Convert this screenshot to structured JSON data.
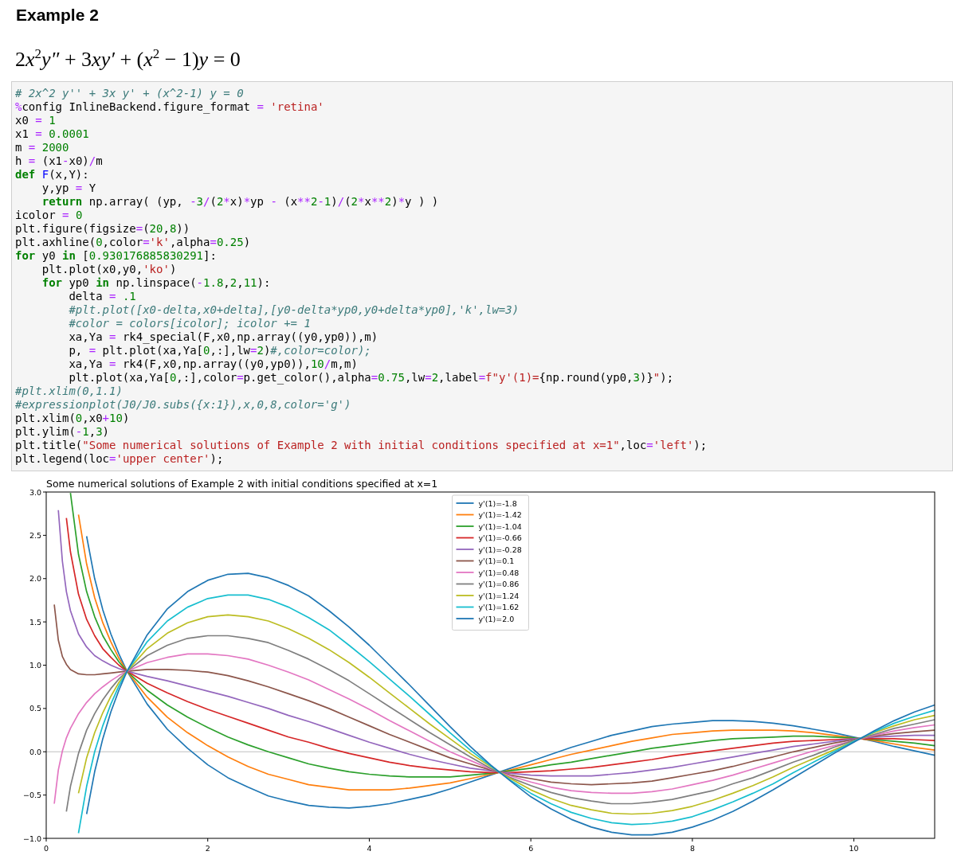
{
  "heading": "Example 2",
  "equation": [
    {
      "kind": "number",
      "text": "2"
    },
    {
      "kind": "variable",
      "text": "x"
    },
    {
      "kind": "power",
      "text": "2"
    },
    {
      "kind": "variable",
      "text": "y″"
    },
    {
      "kind": "operator",
      "text": " + 3"
    },
    {
      "kind": "variable",
      "text": "xy′"
    },
    {
      "kind": "operator",
      "text": " + ("
    },
    {
      "kind": "variable",
      "text": "x"
    },
    {
      "kind": "power",
      "text": "2"
    },
    {
      "kind": "operator",
      "text": " − 1)"
    },
    {
      "kind": "variable",
      "text": "y"
    },
    {
      "kind": "operator",
      "text": " = 0"
    }
  ],
  "code_cell": {
    "lines": [
      [
        {
          "kind": "comment",
          "text": "# 2x^2 y'' + 3x y' + (x^2-1) y = 0"
        }
      ],
      [
        {
          "kind": "operator",
          "text": "%"
        },
        {
          "kind": "text",
          "text": "config InlineBackend.figure_format "
        },
        {
          "kind": "operator",
          "text": "="
        },
        {
          "kind": "string",
          "text": " 'retina'"
        }
      ],
      [
        {
          "kind": "text",
          "text": "x0 "
        },
        {
          "kind": "operator",
          "text": "="
        },
        {
          "kind": "number",
          "text": " 1"
        }
      ],
      [
        {
          "kind": "text",
          "text": "x1 "
        },
        {
          "kind": "operator",
          "text": "="
        },
        {
          "kind": "number",
          "text": " 0.0001"
        }
      ],
      [
        {
          "kind": "text",
          "text": "m "
        },
        {
          "kind": "operator",
          "text": "="
        },
        {
          "kind": "number",
          "text": " 2000"
        }
      ],
      [
        {
          "kind": "text",
          "text": "h "
        },
        {
          "kind": "operator",
          "text": "="
        },
        {
          "kind": "text",
          "text": " (x1"
        },
        {
          "kind": "operator",
          "text": "-"
        },
        {
          "kind": "text",
          "text": "x0)"
        },
        {
          "kind": "operator",
          "text": "/"
        },
        {
          "kind": "text",
          "text": "m"
        }
      ],
      [
        {
          "kind": "keyword",
          "text": "def"
        },
        {
          "kind": "name",
          "text": " F"
        },
        {
          "kind": "text",
          "text": "(x,Y):"
        }
      ],
      [
        {
          "kind": "text",
          "text": "    y,yp "
        },
        {
          "kind": "operator",
          "text": "="
        },
        {
          "kind": "text",
          "text": " Y"
        }
      ],
      [
        {
          "kind": "keyword",
          "text": "    return"
        },
        {
          "kind": "text",
          "text": " np.array( (yp, "
        },
        {
          "kind": "operator",
          "text": "-"
        },
        {
          "kind": "number",
          "text": "3"
        },
        {
          "kind": "operator",
          "text": "/"
        },
        {
          "kind": "text",
          "text": "("
        },
        {
          "kind": "number",
          "text": "2"
        },
        {
          "kind": "operator",
          "text": "*"
        },
        {
          "kind": "text",
          "text": "x)"
        },
        {
          "kind": "operator",
          "text": "*"
        },
        {
          "kind": "text",
          "text": "yp "
        },
        {
          "kind": "operator",
          "text": "-"
        },
        {
          "kind": "text",
          "text": " (x"
        },
        {
          "kind": "operator",
          "text": "**"
        },
        {
          "kind": "number",
          "text": "2"
        },
        {
          "kind": "operator",
          "text": "-"
        },
        {
          "kind": "number",
          "text": "1"
        },
        {
          "kind": "text",
          "text": ")"
        },
        {
          "kind": "operator",
          "text": "/"
        },
        {
          "kind": "text",
          "text": "("
        },
        {
          "kind": "number",
          "text": "2"
        },
        {
          "kind": "operator",
          "text": "*"
        },
        {
          "kind": "text",
          "text": "x"
        },
        {
          "kind": "operator",
          "text": "**"
        },
        {
          "kind": "number",
          "text": "2"
        },
        {
          "kind": "text",
          "text": ")"
        },
        {
          "kind": "operator",
          "text": "*"
        },
        {
          "kind": "text",
          "text": "y ) )"
        }
      ],
      [
        {
          "kind": "text",
          "text": "icolor "
        },
        {
          "kind": "operator",
          "text": "="
        },
        {
          "kind": "number",
          "text": " 0"
        }
      ],
      [
        {
          "kind": "text",
          "text": "plt.figure(figsize"
        },
        {
          "kind": "operator",
          "text": "="
        },
        {
          "kind": "text",
          "text": "("
        },
        {
          "kind": "number",
          "text": "20"
        },
        {
          "kind": "text",
          "text": ","
        },
        {
          "kind": "number",
          "text": "8"
        },
        {
          "kind": "text",
          "text": "))"
        }
      ],
      [
        {
          "kind": "text",
          "text": "plt.axhline("
        },
        {
          "kind": "number",
          "text": "0"
        },
        {
          "kind": "text",
          "text": ",color"
        },
        {
          "kind": "operator",
          "text": "="
        },
        {
          "kind": "string",
          "text": "'k'"
        },
        {
          "kind": "text",
          "text": ",alpha"
        },
        {
          "kind": "operator",
          "text": "="
        },
        {
          "kind": "number",
          "text": "0.25"
        },
        {
          "kind": "text",
          "text": ")"
        }
      ],
      [
        {
          "kind": "keyword",
          "text": "for"
        },
        {
          "kind": "text",
          "text": " y0 "
        },
        {
          "kind": "keyword",
          "text": "in"
        },
        {
          "kind": "text",
          "text": " ["
        },
        {
          "kind": "number",
          "text": "0.930176885830291"
        },
        {
          "kind": "text",
          "text": "]:"
        }
      ],
      [
        {
          "kind": "text",
          "text": "    plt.plot(x0,y0,"
        },
        {
          "kind": "string",
          "text": "'ko'"
        },
        {
          "kind": "text",
          "text": ")"
        }
      ],
      [
        {
          "kind": "keyword",
          "text": "    for"
        },
        {
          "kind": "text",
          "text": " yp0 "
        },
        {
          "kind": "keyword",
          "text": "in"
        },
        {
          "kind": "text",
          "text": " np.linspace("
        },
        {
          "kind": "operator",
          "text": "-"
        },
        {
          "kind": "number",
          "text": "1.8"
        },
        {
          "kind": "text",
          "text": ","
        },
        {
          "kind": "number",
          "text": "2"
        },
        {
          "kind": "text",
          "text": ","
        },
        {
          "kind": "number",
          "text": "11"
        },
        {
          "kind": "text",
          "text": "):"
        }
      ],
      [
        {
          "kind": "text",
          "text": "        delta "
        },
        {
          "kind": "operator",
          "text": "="
        },
        {
          "kind": "number",
          "text": " .1"
        }
      ],
      [
        {
          "kind": "comment",
          "text": "        #plt.plot([x0-delta,x0+delta],[y0-delta*yp0,y0+delta*yp0],'k',lw=3)"
        }
      ],
      [
        {
          "kind": "comment",
          "text": "        #color = colors[icolor]; icolor += 1"
        }
      ],
      [
        {
          "kind": "text",
          "text": "        xa,Ya "
        },
        {
          "kind": "operator",
          "text": "="
        },
        {
          "kind": "text",
          "text": " rk4_special(F,x0,np.array((y0,yp0)),m)"
        }
      ],
      [
        {
          "kind": "text",
          "text": "        p, "
        },
        {
          "kind": "operator",
          "text": "="
        },
        {
          "kind": "text",
          "text": " plt.plot(xa,Ya["
        },
        {
          "kind": "number",
          "text": "0"
        },
        {
          "kind": "text",
          "text": ",:],lw"
        },
        {
          "kind": "operator",
          "text": "="
        },
        {
          "kind": "number",
          "text": "2"
        },
        {
          "kind": "text",
          "text": ")"
        },
        {
          "kind": "comment",
          "text": "#,color=color);"
        }
      ],
      [
        {
          "kind": "text",
          "text": "        xa,Ya "
        },
        {
          "kind": "operator",
          "text": "="
        },
        {
          "kind": "text",
          "text": " rk4(F,x0,np.array((y0,yp0)),"
        },
        {
          "kind": "number",
          "text": "10"
        },
        {
          "kind": "operator",
          "text": "/"
        },
        {
          "kind": "text",
          "text": "m,m)"
        }
      ],
      [
        {
          "kind": "text",
          "text": "        plt.plot(xa,Ya["
        },
        {
          "kind": "number",
          "text": "0"
        },
        {
          "kind": "text",
          "text": ",:],color"
        },
        {
          "kind": "operator",
          "text": "="
        },
        {
          "kind": "text",
          "text": "p.get_color(),alpha"
        },
        {
          "kind": "operator",
          "text": "="
        },
        {
          "kind": "number",
          "text": "0.75"
        },
        {
          "kind": "text",
          "text": ",lw"
        },
        {
          "kind": "operator",
          "text": "="
        },
        {
          "kind": "number",
          "text": "2"
        },
        {
          "kind": "text",
          "text": ",label"
        },
        {
          "kind": "operator",
          "text": "="
        },
        {
          "kind": "string",
          "text": "f\"y'(1)="
        },
        {
          "kind": "text",
          "text": "{np.round(yp0,"
        },
        {
          "kind": "number",
          "text": "3"
        },
        {
          "kind": "text",
          "text": ")}"
        },
        {
          "kind": "string",
          "text": "\""
        },
        {
          "kind": "text",
          "text": ");"
        }
      ],
      [
        {
          "kind": "comment",
          "text": "#plt.xlim(0,1.1)"
        }
      ],
      [
        {
          "kind": "comment",
          "text": "#expressionplot(J0/J0.subs({x:1}),x,0,8,color='g')"
        }
      ],
      [
        {
          "kind": "text",
          "text": "plt.xlim("
        },
        {
          "kind": "number",
          "text": "0"
        },
        {
          "kind": "text",
          "text": ",x0"
        },
        {
          "kind": "operator",
          "text": "+"
        },
        {
          "kind": "number",
          "text": "10"
        },
        {
          "kind": "text",
          "text": ")"
        }
      ],
      [
        {
          "kind": "text",
          "text": "plt.ylim("
        },
        {
          "kind": "operator",
          "text": "-"
        },
        {
          "kind": "number",
          "text": "1"
        },
        {
          "kind": "text",
          "text": ","
        },
        {
          "kind": "number",
          "text": "3"
        },
        {
          "kind": "text",
          "text": ")"
        }
      ],
      [
        {
          "kind": "text",
          "text": "plt.title("
        },
        {
          "kind": "string",
          "text": "\"Some numerical solutions of Example 2 with initial conditions specified at x=1\""
        },
        {
          "kind": "text",
          "text": ",loc"
        },
        {
          "kind": "operator",
          "text": "="
        },
        {
          "kind": "string",
          "text": "'left'"
        },
        {
          "kind": "text",
          "text": ");"
        }
      ],
      [
        {
          "kind": "text",
          "text": "plt.legend(loc"
        },
        {
          "kind": "operator",
          "text": "="
        },
        {
          "kind": "string",
          "text": "'upper center'"
        },
        {
          "kind": "text",
          "text": ");"
        }
      ]
    ]
  },
  "output": {
    "chart_data": {
      "type": "line",
      "title": "Some numerical solutions of Example 2 with initial conditions specified at x=1",
      "x": [
        0.1,
        0.15,
        0.2,
        0.25,
        0.3,
        0.4,
        0.5,
        0.6,
        0.7,
        0.8,
        0.9,
        1,
        1.25,
        1.5,
        1.75,
        2,
        2.25,
        2.5,
        2.75,
        3,
        3.25,
        3.5,
        3.75,
        4,
        4.25,
        4.5,
        4.75,
        5,
        5.25,
        5.5,
        5.75,
        6,
        6.25,
        6.5,
        6.75,
        7,
        7.25,
        7.5,
        7.75,
        8,
        8.25,
        8.5,
        8.75,
        9,
        9.25,
        9.5,
        9.75,
        10,
        10.25,
        10.5,
        10.75,
        11
      ],
      "xlim": [
        0,
        11
      ],
      "ylim": [
        -1,
        3
      ],
      "xticks": [
        {
          "value": 0,
          "label": "0"
        },
        {
          "value": 2,
          "label": "2"
        },
        {
          "value": 4,
          "label": "4"
        },
        {
          "value": 6,
          "label": "6"
        },
        {
          "value": 8,
          "label": "8"
        },
        {
          "value": 10,
          "label": "10"
        }
      ],
      "yticks": [
        {
          "value": -1,
          "label": "−1.0"
        },
        {
          "value": -0.5,
          "label": "−0.5"
        },
        {
          "value": 0,
          "label": "0.0"
        },
        {
          "value": 0.5,
          "label": "0.5"
        },
        {
          "value": 1,
          "label": "1.0"
        },
        {
          "value": 1.5,
          "label": "1.5"
        },
        {
          "value": 2,
          "label": "2.0"
        },
        {
          "value": 2.5,
          "label": "2.5"
        },
        {
          "value": 3,
          "label": "3.0"
        }
      ],
      "ref_lines": [
        {
          "axis": "y",
          "value": 0
        }
      ],
      "legend": "upper center",
      "series": [
        {
          "name": "y'(1)=-1.8",
          "color": "#1f77b4",
          "values": [
            null,
            null,
            null,
            null,
            null,
            null,
            2.49,
            2.0,
            1.64,
            1.36,
            1.13,
            0.93,
            0.55,
            0.26,
            0.04,
            -0.15,
            -0.3,
            -0.41,
            -0.51,
            -0.57,
            -0.62,
            -0.64,
            -0.65,
            -0.63,
            -0.6,
            -0.55,
            -0.5,
            -0.43,
            -0.35,
            -0.27,
            -0.19,
            -0.11,
            -0.03,
            0.05,
            0.12,
            0.19,
            0.24,
            0.29,
            0.32,
            0.34,
            0.36,
            0.36,
            0.35,
            0.33,
            0.3,
            0.26,
            0.22,
            0.17,
            0.12,
            0.06,
            0.01,
            -0.04
          ]
        },
        {
          "name": "y'(1)=-1.42",
          "color": "#ff7f0e",
          "values": [
            null,
            null,
            null,
            null,
            null,
            2.74,
            2.17,
            1.78,
            1.49,
            1.27,
            1.08,
            0.93,
            0.63,
            0.4,
            0.22,
            0.07,
            -0.06,
            -0.17,
            -0.26,
            -0.32,
            -0.38,
            -0.41,
            -0.44,
            -0.44,
            -0.44,
            -0.42,
            -0.39,
            -0.36,
            -0.31,
            -0.26,
            -0.21,
            -0.15,
            -0.09,
            -0.03,
            0.02,
            0.07,
            0.12,
            0.16,
            0.2,
            0.22,
            0.24,
            0.25,
            0.25,
            0.25,
            0.24,
            0.22,
            0.19,
            0.16,
            0.13,
            0.09,
            0.05,
            0.02
          ]
        },
        {
          "name": "y'(1)=-1.04",
          "color": "#2ca02c",
          "values": [
            null,
            null,
            null,
            null,
            2.99,
            2.28,
            1.85,
            1.56,
            1.34,
            1.18,
            1.04,
            0.93,
            0.71,
            0.54,
            0.4,
            0.28,
            0.17,
            0.08,
            0.0,
            -0.07,
            -0.14,
            -0.19,
            -0.23,
            -0.26,
            -0.28,
            -0.29,
            -0.29,
            -0.29,
            -0.27,
            -0.25,
            -0.22,
            -0.19,
            -0.15,
            -0.12,
            -0.08,
            -0.04,
            0.0,
            0.04,
            0.07,
            0.1,
            0.13,
            0.15,
            0.16,
            0.17,
            0.18,
            0.18,
            0.17,
            0.16,
            0.14,
            0.12,
            0.1,
            0.07
          ]
        },
        {
          "name": "y'(1)=-0.66",
          "color": "#d62728",
          "values": [
            null,
            null,
            null,
            2.7,
            2.31,
            1.82,
            1.53,
            1.34,
            1.19,
            1.09,
            1.0,
            0.93,
            0.79,
            0.68,
            0.58,
            0.49,
            0.41,
            0.33,
            0.25,
            0.17,
            0.11,
            0.04,
            -0.02,
            -0.07,
            -0.12,
            -0.16,
            -0.19,
            -0.21,
            -0.23,
            -0.24,
            -0.24,
            -0.23,
            -0.22,
            -0.2,
            -0.18,
            -0.15,
            -0.12,
            -0.09,
            -0.05,
            -0.02,
            0.01,
            0.04,
            0.07,
            0.1,
            0.12,
            0.13,
            0.14,
            0.15,
            0.15,
            0.15,
            0.14,
            0.13
          ]
        },
        {
          "name": "y'(1)=-0.28",
          "color": "#9467bd",
          "values": [
            null,
            2.79,
            2.2,
            1.85,
            1.63,
            1.36,
            1.21,
            1.11,
            1.05,
            1.0,
            0.96,
            0.93,
            0.87,
            0.82,
            0.76,
            0.7,
            0.64,
            0.57,
            0.5,
            0.42,
            0.35,
            0.27,
            0.19,
            0.11,
            0.04,
            -0.03,
            -0.09,
            -0.14,
            -0.19,
            -0.22,
            -0.25,
            -0.27,
            -0.28,
            -0.28,
            -0.28,
            -0.26,
            -0.24,
            -0.21,
            -0.18,
            -0.14,
            -0.1,
            -0.06,
            -0.02,
            0.02,
            0.06,
            0.09,
            0.12,
            0.15,
            0.17,
            0.18,
            0.19,
            0.19
          ]
        },
        {
          "name": "y'(1)=0.1",
          "color": "#8c564b",
          "values": [
            1.7,
            1.29,
            1.1,
            1.01,
            0.95,
            0.9,
            0.89,
            0.89,
            0.9,
            0.91,
            0.92,
            0.93,
            0.95,
            0.95,
            0.94,
            0.92,
            0.88,
            0.82,
            0.75,
            0.67,
            0.59,
            0.5,
            0.4,
            0.3,
            0.2,
            0.11,
            0.02,
            -0.07,
            -0.14,
            -0.21,
            -0.27,
            -0.31,
            -0.35,
            -0.37,
            -0.38,
            -0.37,
            -0.36,
            -0.34,
            -0.3,
            -0.26,
            -0.22,
            -0.17,
            -0.11,
            -0.06,
            0.0,
            0.05,
            0.1,
            0.14,
            0.18,
            0.21,
            0.23,
            0.25
          ]
        },
        {
          "name": "y'(1)=0.48",
          "color": "#e377c2",
          "values": [
            -0.6,
            -0.21,
            0.01,
            0.16,
            0.27,
            0.44,
            0.57,
            0.67,
            0.75,
            0.82,
            0.88,
            0.93,
            1.03,
            1.09,
            1.13,
            1.13,
            1.11,
            1.07,
            1.0,
            0.92,
            0.83,
            0.72,
            0.61,
            0.49,
            0.36,
            0.24,
            0.12,
            0.0,
            -0.1,
            -0.2,
            -0.28,
            -0.35,
            -0.41,
            -0.45,
            -0.47,
            -0.48,
            -0.48,
            -0.46,
            -0.43,
            -0.38,
            -0.33,
            -0.27,
            -0.2,
            -0.13,
            -0.06,
            0.01,
            0.07,
            0.13,
            0.19,
            0.24,
            0.28,
            0.31
          ]
        },
        {
          "name": "y'(1)=0.86",
          "color": "#7f7f7f",
          "values": [
            null,
            null,
            null,
            -0.69,
            -0.4,
            -0.02,
            0.25,
            0.44,
            0.6,
            0.73,
            0.84,
            0.93,
            1.11,
            1.23,
            1.31,
            1.34,
            1.34,
            1.31,
            1.26,
            1.17,
            1.07,
            0.95,
            0.82,
            0.67,
            0.52,
            0.37,
            0.22,
            0.08,
            -0.06,
            -0.19,
            -0.3,
            -0.39,
            -0.47,
            -0.53,
            -0.57,
            -0.6,
            -0.6,
            -0.58,
            -0.55,
            -0.5,
            -0.45,
            -0.37,
            -0.3,
            -0.21,
            -0.12,
            -0.04,
            0.05,
            0.13,
            0.2,
            0.27,
            0.32,
            0.37
          ]
        },
        {
          "name": "y'(1)=1.24",
          "color": "#bcbd22",
          "values": [
            null,
            null,
            null,
            null,
            null,
            -0.48,
            -0.07,
            0.22,
            0.45,
            0.64,
            0.8,
            0.93,
            1.19,
            1.37,
            1.49,
            1.56,
            1.58,
            1.56,
            1.51,
            1.42,
            1.31,
            1.18,
            1.03,
            0.86,
            0.68,
            0.5,
            0.32,
            0.15,
            -0.02,
            -0.17,
            -0.31,
            -0.44,
            -0.54,
            -0.62,
            -0.67,
            -0.71,
            -0.72,
            -0.71,
            -0.68,
            -0.63,
            -0.56,
            -0.48,
            -0.39,
            -0.29,
            -0.18,
            -0.08,
            0.02,
            0.12,
            0.22,
            0.3,
            0.37,
            0.42
          ]
        },
        {
          "name": "y'(1)=1.62",
          "color": "#17becf",
          "values": [
            null,
            null,
            null,
            null,
            null,
            -0.94,
            -0.4,
            0.0,
            0.3,
            0.55,
            0.76,
            0.93,
            1.27,
            1.51,
            1.67,
            1.77,
            1.81,
            1.81,
            1.76,
            1.67,
            1.55,
            1.41,
            1.23,
            1.04,
            0.84,
            0.64,
            0.43,
            0.22,
            0.02,
            -0.16,
            -0.33,
            -0.48,
            -0.6,
            -0.7,
            -0.77,
            -0.82,
            -0.84,
            -0.83,
            -0.8,
            -0.75,
            -0.67,
            -0.58,
            -0.48,
            -0.37,
            -0.24,
            -0.12,
            0.0,
            0.12,
            0.23,
            0.33,
            0.41,
            0.48
          ]
        },
        {
          "name": "y'(1)=2.0",
          "color": "#1f77b4",
          "values": [
            null,
            null,
            null,
            null,
            null,
            null,
            -0.72,
            -0.23,
            0.15,
            0.46,
            0.71,
            0.93,
            1.35,
            1.65,
            1.85,
            1.98,
            2.05,
            2.06,
            2.01,
            1.92,
            1.8,
            1.63,
            1.44,
            1.23,
            1.0,
            0.77,
            0.53,
            0.29,
            0.06,
            -0.15,
            -0.34,
            -0.52,
            -0.66,
            -0.78,
            -0.87,
            -0.93,
            -0.96,
            -0.96,
            -0.93,
            -0.87,
            -0.79,
            -0.69,
            -0.57,
            -0.44,
            -0.3,
            -0.16,
            -0.02,
            0.11,
            0.24,
            0.36,
            0.46,
            0.54
          ]
        }
      ]
    }
  }
}
